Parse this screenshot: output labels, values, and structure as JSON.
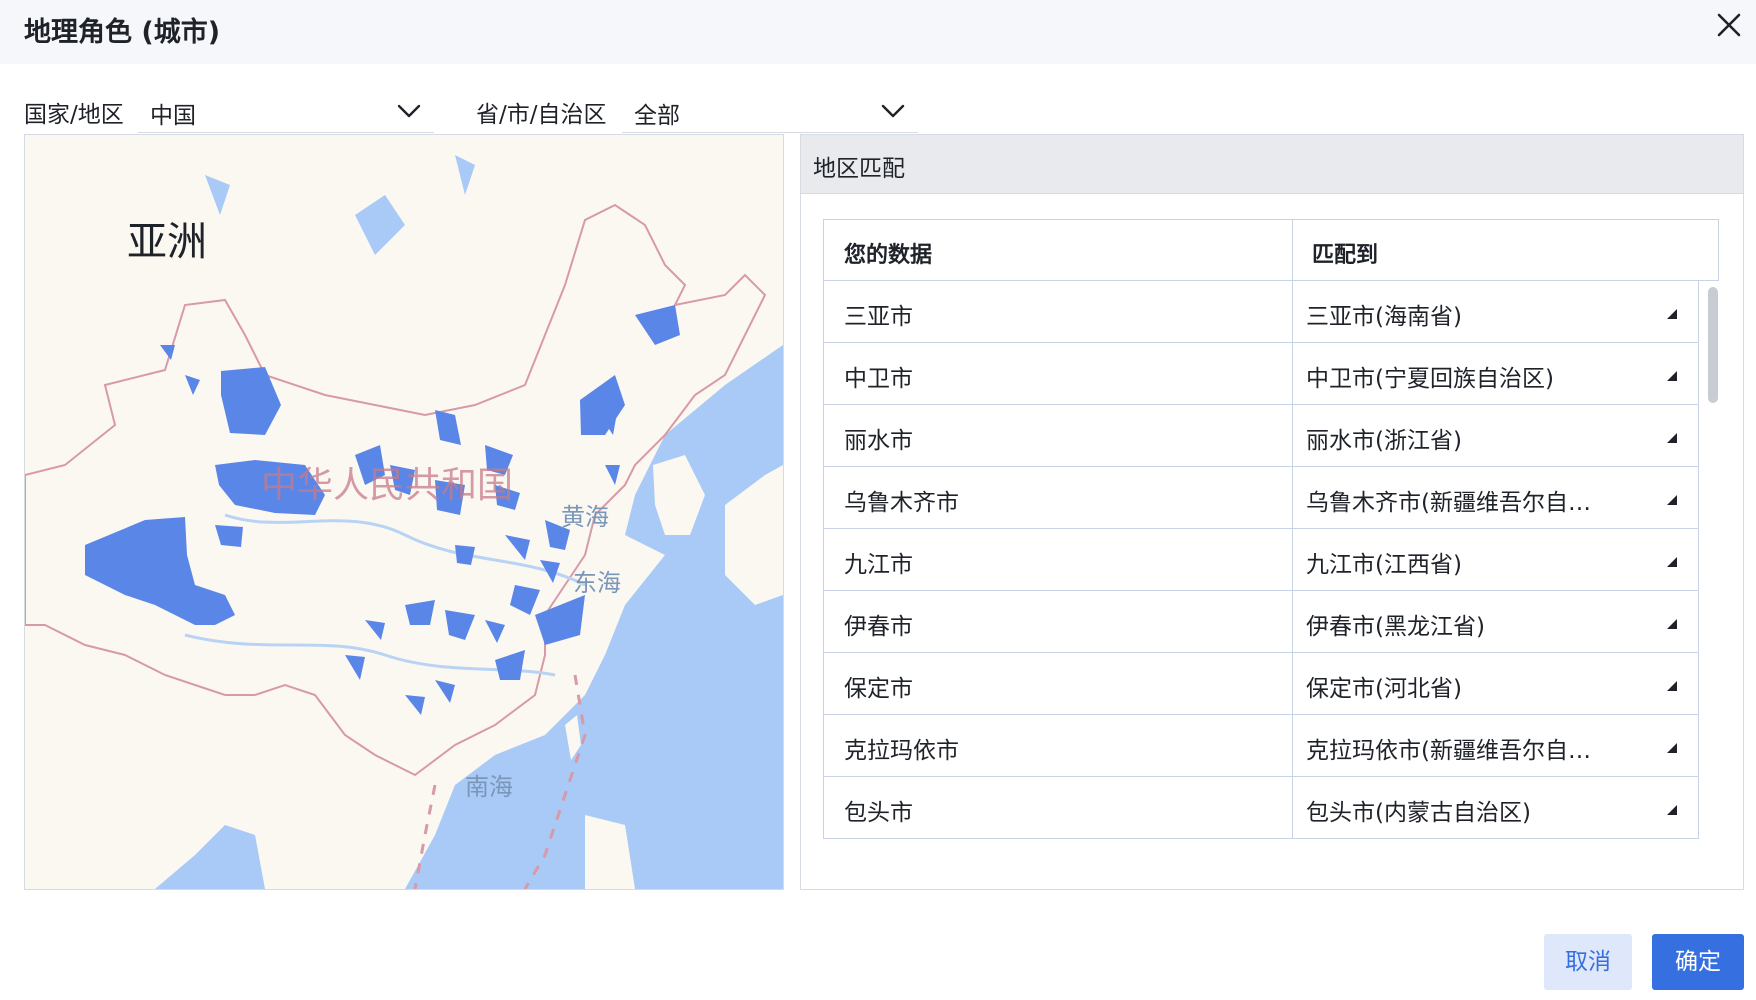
{
  "dialog": {
    "title": "地理角色 (城市)",
    "close_icon": "close-icon"
  },
  "filters": {
    "country_label": "国家/地区",
    "country_value": "中国",
    "province_label": "省/市/自治区",
    "province_value": "全部"
  },
  "map": {
    "labels": {
      "continent": "亚洲",
      "country": "中华人民共和国",
      "yellow_sea": "黄海",
      "east_sea": "东海",
      "south_sea": "南海"
    },
    "colors": {
      "sea": "#a9c9f6",
      "land": "#fbf8f2",
      "region": "#5a86e8",
      "border": "#d79aa6"
    }
  },
  "match_panel": {
    "title": "地区匹配",
    "columns": {
      "your_data": "您的数据",
      "matched_to": "匹配到"
    },
    "rows": [
      {
        "data": "三亚市",
        "match": "三亚市(海南省)"
      },
      {
        "data": "中卫市",
        "match": "中卫市(宁夏回族自治区)"
      },
      {
        "data": "丽水市",
        "match": "丽水市(浙江省)"
      },
      {
        "data": "乌鲁木齐市",
        "match": "乌鲁木齐市(新疆维吾尔自…"
      },
      {
        "data": "九江市",
        "match": "九江市(江西省)"
      },
      {
        "data": "伊春市",
        "match": "伊春市(黑龙江省)"
      },
      {
        "data": "保定市",
        "match": "保定市(河北省)"
      },
      {
        "data": "克拉玛依市",
        "match": "克拉玛依市(新疆维吾尔自…"
      },
      {
        "data": "包头市",
        "match": "包头市(内蒙古自治区)"
      }
    ]
  },
  "buttons": {
    "cancel": "取消",
    "ok": "确定"
  },
  "theme": {
    "primary": "#3670e0",
    "header_bg": "#f5f7fb"
  }
}
